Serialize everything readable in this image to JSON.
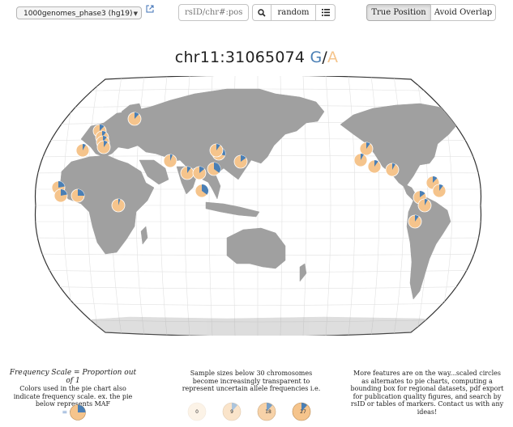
{
  "toolbar": {
    "dataset_label": "1000genomes_phase3 (hg19)",
    "search_placeholder": "rsID/chr#:pos",
    "random_label": "random",
    "true_position_label": "True Position",
    "avoid_overlap_label": "Avoid Overlap",
    "active_view": "True Position"
  },
  "title": {
    "variant": "chr11:31065074",
    "ref_allele": "G",
    "separator": "/",
    "alt_allele": "A"
  },
  "colors": {
    "ref": "#4a7fb5",
    "alt": "#f5c48c",
    "land": "#a0a0a0",
    "ocean": "#ffffff",
    "graticule": "#dddddd"
  },
  "legend": {
    "freq_title": "Frequency Scale = Proportion out of 1",
    "freq_text": "Colors used in the pie chart also indicate frequency scale. ex. the pie below represents MAF",
    "freq_value": "= 0.25",
    "sample_text": "Sample sizes below 30 chromosomes become increasingly transparent to represent uncertain allele frequencies i.e.",
    "sample_examples": [
      "0",
      "9",
      "18",
      "27"
    ],
    "features_text": "More features are on the way...scaled circles as alternates to pie charts, computing a bounding box for regional datasets, pdf export for publication quality figures, and search by rsID or tables of markers. Contact us with any ideas!"
  }
}
